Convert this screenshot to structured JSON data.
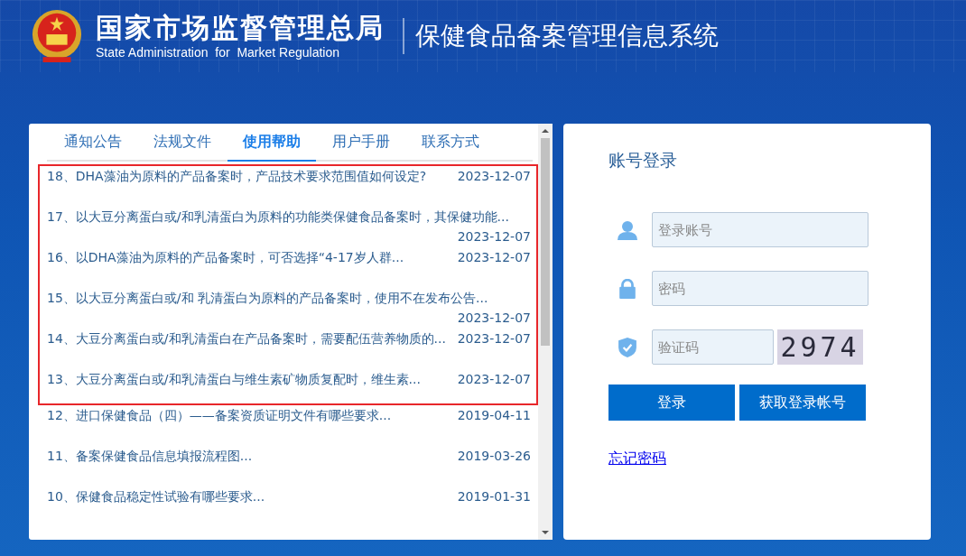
{
  "header": {
    "title": "国家市场监督管理总局",
    "subtitle": "State Administration  for  Market Regulation",
    "system": "保健食品备案管理信息系统"
  },
  "tabs": [
    {
      "label": "通知公告",
      "selected": false
    },
    {
      "label": "法规文件",
      "selected": false
    },
    {
      "label": "使用帮助",
      "selected": true
    },
    {
      "label": "用户手册",
      "selected": false
    },
    {
      "label": "联系方式",
      "selected": false
    }
  ],
  "articles": [
    {
      "title": "18、DHA藻油为原料的产品备案时，产品技术要求范围值如何设定?",
      "date": "2023-12-07",
      "highlighted": true
    },
    {
      "title": "17、以大豆分离蛋白或/和乳清蛋白为原料的功能类保健食品备案时，其保健功能...",
      "date": "2023-12-07",
      "highlighted": true
    },
    {
      "title": "16、以DHA藻油为原料的产品备案时，可否选择“4-17岁人群...",
      "date": "2023-12-07",
      "highlighted": true
    },
    {
      "title": "15、以大豆分离蛋白或/和 乳清蛋白为原料的产品备案时，使用不在发布公告...",
      "date": "2023-12-07",
      "highlighted": true
    },
    {
      "title": "14、大豆分离蛋白或/和乳清蛋白在产品备案时，需要配伍营养物质的...",
      "date": "2023-12-07",
      "highlighted": true
    },
    {
      "title": "13、大豆分离蛋白或/和乳清蛋白与维生素矿物质复配时，维生素...",
      "date": "2023-12-07",
      "highlighted": true
    },
    {
      "title": "12、进口保健食品（四）——备案资质证明文件有哪些要求...",
      "date": "2019-04-11",
      "highlighted": false
    },
    {
      "title": "11、备案保健食品信息填报流程图...",
      "date": "2019-03-26",
      "highlighted": false
    },
    {
      "title": "10、保健食品稳定性试验有哪些要求...",
      "date": "2019-01-31",
      "highlighted": false
    }
  ],
  "login": {
    "title": "账号登录",
    "account": {
      "placeholder": "登录账号"
    },
    "password": {
      "placeholder": "密码"
    },
    "captcha": {
      "placeholder": "验证码",
      "image_text": "2974"
    },
    "buttons": [
      "登录",
      "获取登录帐号"
    ],
    "forgot_link": "忘记密码"
  }
}
